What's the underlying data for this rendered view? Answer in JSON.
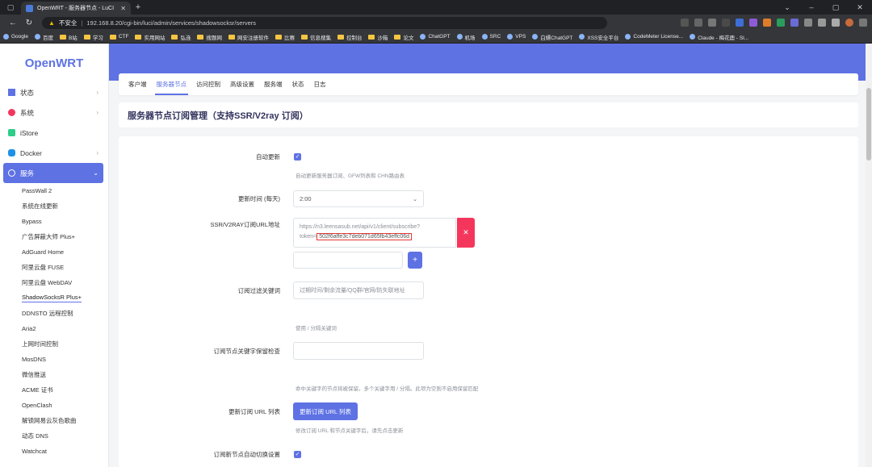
{
  "browser": {
    "tab_title": "OpenWRT - 服务器节点 - LuCI",
    "security_label": "不安全",
    "url": "192.168.8.20/cgi-bin/luci/admin/services/shadowsocksr/servers",
    "bookmarks": [
      "Google",
      "百度",
      "B站",
      "学习",
      "CTF",
      "实用网站",
      "弘连",
      "搜题网",
      "网安注册软件",
      "比赛",
      "信息搜集",
      "控制台",
      "沙箱",
      "论文",
      "ChatGPT",
      "机场",
      "SRC",
      "VPS",
      "白嫖ChatGPT",
      "XSS安全平台",
      "CodeMeter License...",
      "Claude - 梅花鹿 - Sl..."
    ]
  },
  "brand": "OpenWRT",
  "sidebar": {
    "items": [
      {
        "label": "状态",
        "icon": "dashboard-icon"
      },
      {
        "label": "系统",
        "icon": "gear-icon"
      },
      {
        "label": "iStore",
        "icon": "store-icon"
      },
      {
        "label": "Docker",
        "icon": "docker-icon"
      },
      {
        "label": "服务",
        "icon": "services-icon"
      }
    ],
    "sub_items": [
      "PassWall 2",
      "系统在线更新",
      "Bypass",
      "广告屏蔽大师 Plus+",
      "AdGuard Home",
      "阿里云盘 FUSE",
      "阿里云盘 WebDAV",
      "ShadowSocksR Plus+",
      "DDNSTO 远程控制",
      "Aria2",
      "上网时间控制",
      "MosDNS",
      "微信推送",
      "ACME 证书",
      "OpenClash",
      "解锁网易云灰色歌曲",
      "动态 DNS",
      "Watchcat"
    ]
  },
  "tabs": [
    "客户端",
    "服务器节点",
    "访问控制",
    "高级设置",
    "服务端",
    "状态",
    "日志"
  ],
  "page_title": "服务器节点订阅管理（支持SSR/V2ray 订阅）",
  "form": {
    "auto_update_label": "自动更新",
    "auto_update_hint": "自动更新服务器订阅、GFW列表和 CHN路由表",
    "update_time_label": "更新时间 (每天)",
    "update_time_value": "2:00",
    "url_label": "SSR/V2RAY订阅URL地址",
    "url_line1": "https://n3.leensasub.net/api/v1/client/subscribe?",
    "url_line2_prefix": "token=",
    "url_token": "502f6affe3c7deb071d65fb43effc06d",
    "filter_label": "订阅过滤关键词",
    "filter_placeholder": "过期时间/剩余流量/QQ群/官网/防失联地址",
    "filter_hint": "使用 / 分隔关键词",
    "keep_label": "订阅节点关键字保留检查",
    "keep_hint": "命中关键字的节点将被保留。多个关键字用 / 分隔。此项为空则不启用保留匹配",
    "update_list_label": "更新订阅 URL 列表",
    "update_list_button": "更新订阅 URL 列表",
    "update_list_hint": "修改订阅 URL 和节点关键字后，请先点击更新",
    "auto_switch_label": "订阅新节点自动切换设置"
  }
}
